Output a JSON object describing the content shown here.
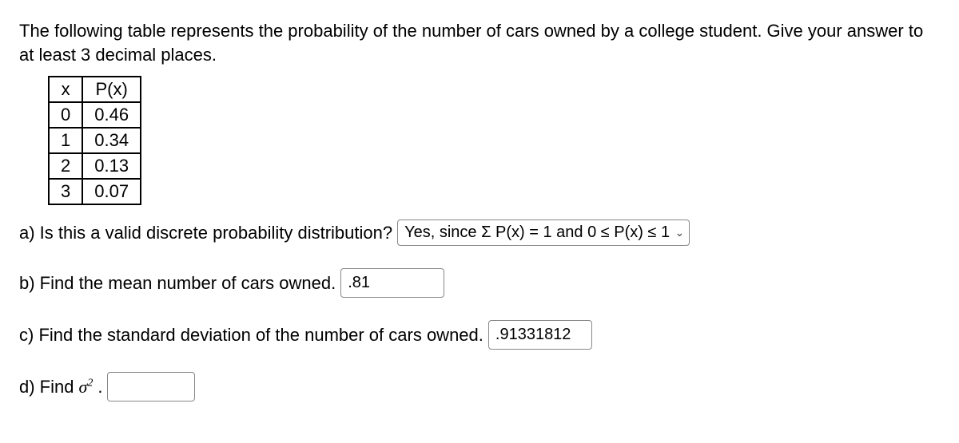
{
  "intro": "The following table represents the probability of the number of cars owned by a college student. Give your answer to at least 3 decimal places.",
  "table": {
    "headers": {
      "x": "x",
      "px": "P(x)"
    },
    "rows": [
      {
        "x": "0",
        "px": "0.46"
      },
      {
        "x": "1",
        "px": "0.34"
      },
      {
        "x": "2",
        "px": "0.13"
      },
      {
        "x": "3",
        "px": "0.07"
      }
    ]
  },
  "qa": {
    "prompt": "a) Is this a valid discrete probability distribution?",
    "select_value": "Yes, since Σ P(x) = 1 and 0 ≤ P(x) ≤ 1"
  },
  "qb": {
    "prompt": "b) Find the mean number of cars owned.",
    "value": ".81"
  },
  "qc": {
    "prompt": "c) Find the standard deviation of the number of cars owned.",
    "value": ".91331812"
  },
  "qd": {
    "prompt_pre": "d) Find ",
    "prompt_post": " .",
    "value": ""
  }
}
